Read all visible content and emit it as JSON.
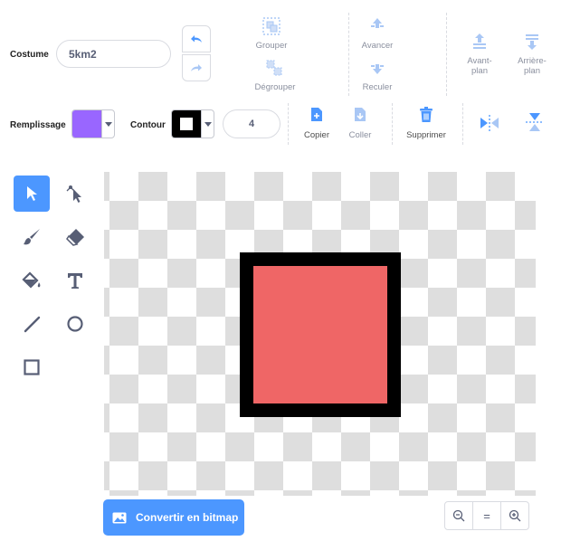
{
  "toolbar": {
    "costume_label": "Costume",
    "costume_name": "5km2",
    "group_label": "Grouper",
    "ungroup_label": "Dégrouper",
    "forward_label": "Avancer",
    "backward_label": "Reculer",
    "front_label_1": "Avant-",
    "front_label_2": "plan",
    "back_label_1": "Arrière-",
    "back_label_2": "plan"
  },
  "properties": {
    "fill_label": "Remplissage",
    "fill_color": "#9966ff",
    "outline_label": "Contour",
    "outline_color": "#000000",
    "outline_width": "4",
    "copy_label": "Copier",
    "paste_label": "Coller",
    "delete_label": "Supprimer"
  },
  "tools": [
    {
      "name": "select-tool",
      "icon": "arrow-cursor-icon",
      "active": true
    },
    {
      "name": "reshape-tool",
      "icon": "reshape-cursor-icon",
      "active": false
    },
    {
      "name": "brush-tool",
      "icon": "brush-icon",
      "active": false
    },
    {
      "name": "eraser-tool",
      "icon": "eraser-icon",
      "active": false
    },
    {
      "name": "fill-tool",
      "icon": "paint-bucket-icon",
      "active": false
    },
    {
      "name": "text-tool",
      "icon": "text-t-icon",
      "active": false
    },
    {
      "name": "line-tool",
      "icon": "line-icon",
      "active": false
    },
    {
      "name": "circle-tool",
      "icon": "circle-icon",
      "active": false
    },
    {
      "name": "rectangle-tool",
      "icon": "rectangle-icon",
      "active": false
    }
  ],
  "canvas": {
    "shape_fill": "#ef6666",
    "shape_stroke": "#000000"
  },
  "footer": {
    "convert_label": "Convertir en bitmap",
    "zoom_reset_label": "="
  },
  "colors": {
    "accent": "#4c97ff",
    "muted": "#8a8f9e"
  }
}
